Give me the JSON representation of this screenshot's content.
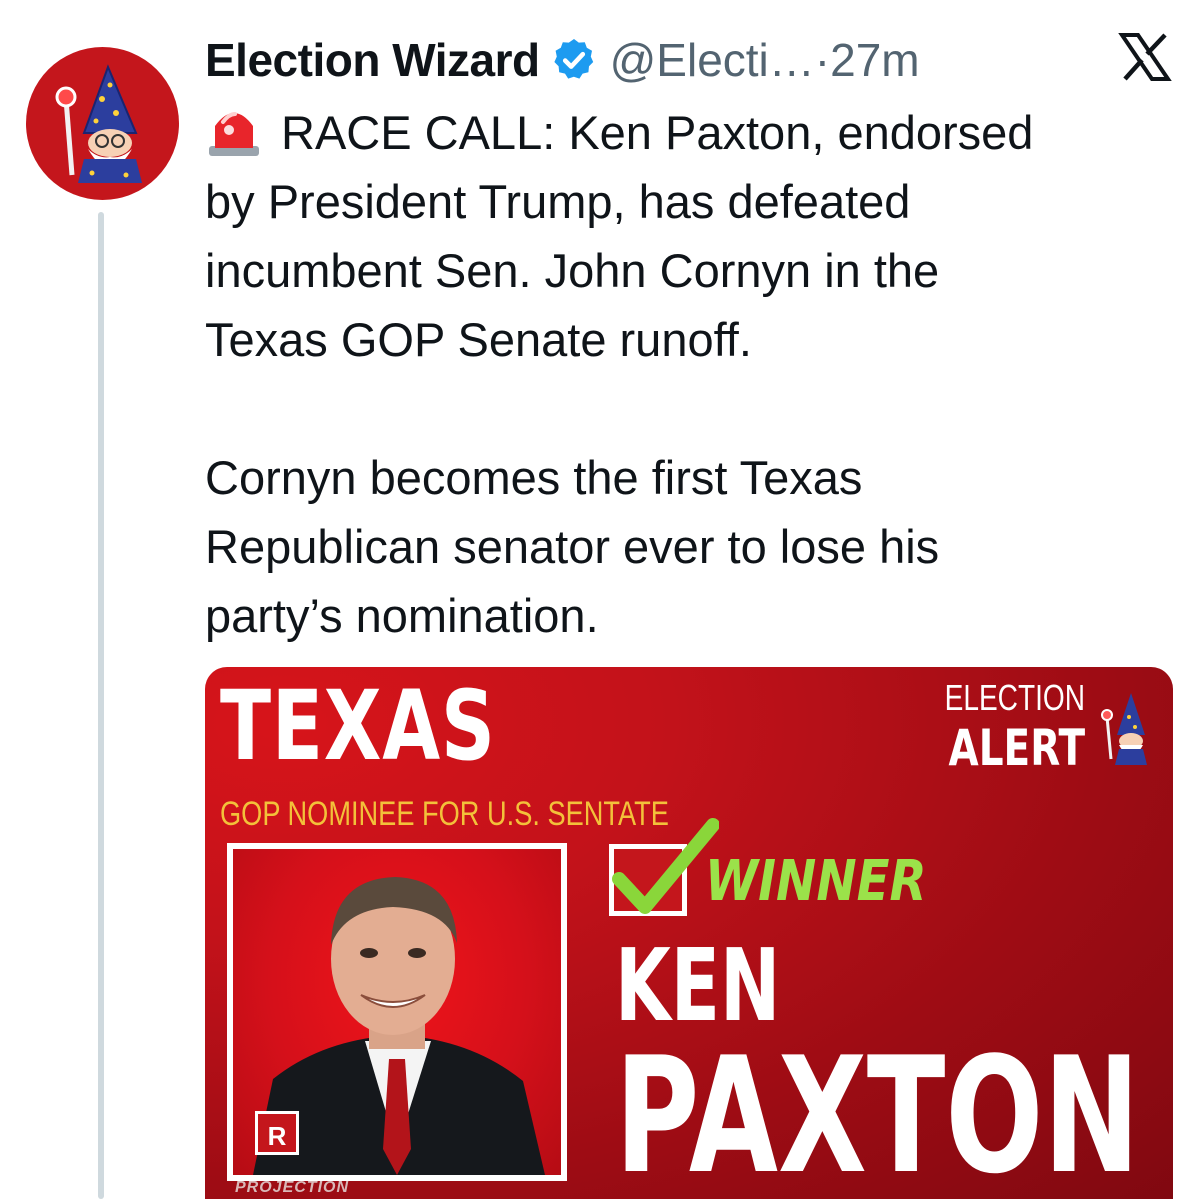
{
  "tweet": {
    "author": {
      "display_name": "Election Wizard",
      "handle": "@Electi…",
      "separator": "·",
      "time": "27m",
      "verified": true,
      "avatar_icon": "wizard-avatar-icon"
    },
    "platform_icon": "x-logo-icon",
    "text": {
      "line_group_1": [
        "RACE CALL: Ken Paxton, endorsed",
        "by President Trump, has defeated",
        "incumbent Sen. John Cornyn in the",
        "Texas GOP Senate runoff."
      ],
      "line_group_2": [
        "Cornyn becomes the first Texas",
        "Republican senator ever to lose his",
        "party’s nomination."
      ],
      "leading_emoji": "siren-icon"
    },
    "media": {
      "state": "TEXAS",
      "subtitle": "GOP NOMINEE FOR U.S. SENTATE",
      "alert_top": "ELECTION",
      "alert_bottom": "ALERT",
      "winner_label": "WINNER",
      "candidate_first": "KEN",
      "candidate_last": "PAXTON",
      "party_badge": "R",
      "projection_label": "PROJECTION"
    }
  },
  "colors": {
    "text_primary": "#0f1419",
    "text_secondary": "#536471",
    "verified_blue": "#1d9bf0",
    "brand_red": "#c4161c",
    "subtitle_gold": "#f3c13a",
    "winner_green": "#9be24a"
  }
}
